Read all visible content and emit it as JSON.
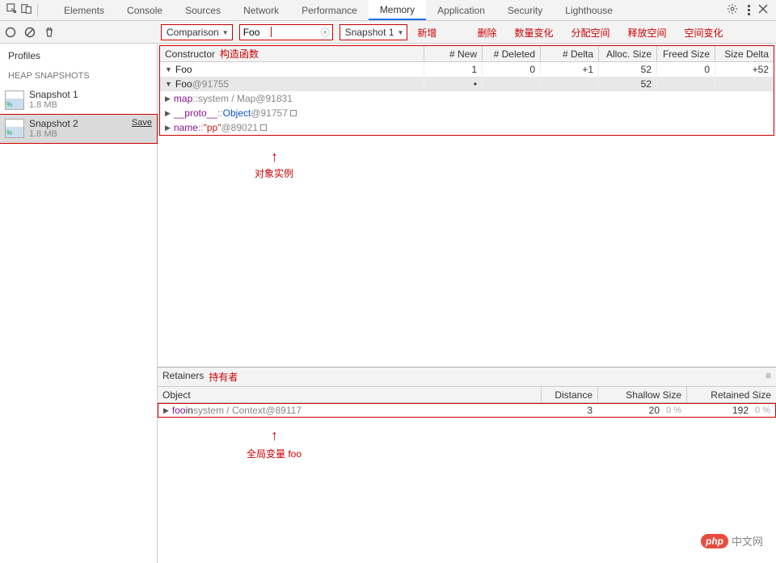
{
  "topTabs": [
    "Elements",
    "Console",
    "Sources",
    "Network",
    "Performance",
    "Memory",
    "Application",
    "Security",
    "Lighthouse"
  ],
  "activeTab": "Memory",
  "sidebar": {
    "title": "Profiles",
    "section": "HEAP SNAPSHOTS",
    "items": [
      {
        "name": "Snapshot 1",
        "size": "1.8 MB"
      },
      {
        "name": "Snapshot 2",
        "size": "1.8 MB",
        "save": "Save"
      }
    ]
  },
  "controls": {
    "viewSelect": "Comparison",
    "filterValue": "Foo",
    "baseSelect": "Snapshot 1"
  },
  "colAnnot": {
    "new": "新增",
    "deleted": "删除",
    "delta": "数量变化",
    "alloc": "分配空间",
    "freed": "释放空间",
    "size": "空间变化"
  },
  "gridHead": {
    "constructor_": "Constructor",
    "conAnnot": "构造函数",
    "new": "# New",
    "deleted": "# Deleted",
    "delta": "# Delta",
    "alloc": "Alloc. Size",
    "freed": "Freed Size",
    "size": "Size Delta"
  },
  "rows": {
    "foo": {
      "label": "Foo",
      "new": "1",
      "deleted": "0",
      "delta": "+1",
      "alloc": "52",
      "freed": "0",
      "size": "+52"
    },
    "fooInst": {
      "label": "Foo",
      "at": "@91755",
      "alloc": "52",
      "new": "•"
    },
    "map": {
      "prop": "map",
      "sep": " :: ",
      "sys": "system / Map",
      "at": "@91831"
    },
    "proto": {
      "prop": "__proto__",
      "sep": " :: ",
      "cls": "Object",
      "at": "@91757"
    },
    "name": {
      "prop": "name",
      "sep": " :: ",
      "str": "\"pp\"",
      "at": "@89021"
    }
  },
  "midAnnot": "对象实例",
  "retainers": {
    "title": "Retainers",
    "titleAnnot": "持有者",
    "head": {
      "obj": "Object",
      "dist": "Distance",
      "shallow": "Shallow Size",
      "retained": "Retained Size"
    },
    "row": {
      "prop": "foo",
      "in": " in ",
      "sys": "system / Context",
      "at": "@89117",
      "dist": "3",
      "shallow": "20",
      "shallowPct": "0 %",
      "retained": "192",
      "retainedPct": "0 %"
    },
    "annot": "全局变量 foo"
  },
  "watermark": {
    "badge": "php",
    "text": "中文网"
  }
}
